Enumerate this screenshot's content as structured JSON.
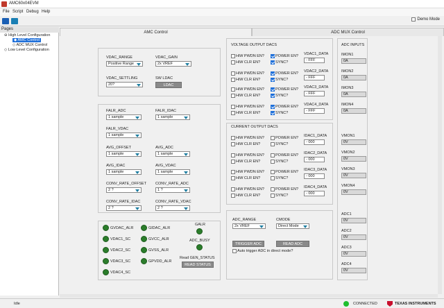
{
  "app": {
    "title": "AMC60x04EVM"
  },
  "menu": [
    "File",
    "Script",
    "Debug",
    "Help"
  ],
  "toolbar": {
    "demo_mode_label": "Demo Mode",
    "demo_mode_checked": false
  },
  "pages": {
    "header": "Pages",
    "items": [
      "High Level Configuration",
      "AMC Control",
      "ADC MUX Control",
      "Low Level Configuration"
    ],
    "selected": "AMC Control"
  },
  "tabs": {
    "amc": "AMC Control",
    "adcmux": "ADC MUX Control"
  },
  "vdac": {
    "range_label": "VDAC_RANGE",
    "range_value": "Positive Range",
    "gain_label": "VDAC_GAIN",
    "gain_value": "2x VREF",
    "settling_label": "VDAC_SETTLING",
    "settling_value": "20?",
    "sw_ldac_label": "SW LDAC",
    "ldac_button": "LDAC"
  },
  "falr": {
    "falr_adc_label": "FALR_ADC",
    "falr_adc_value": "1 sample",
    "falr_idac_label": "FALR_IDAC",
    "falr_idac_value": "1 sample",
    "falr_vdac_label": "FALR_VDAC",
    "falr_vdac_value": "1 sample",
    "avg_offset_label": "AVG_OFFSET",
    "avg_offset_value": "1 sample",
    "avg_adc_label": "AVG_ADC",
    "avg_adc_value": "1 sample",
    "avg_idac_label": "AVG_IDAC",
    "avg_idac_value": "1 sample",
    "avg_vdac_label": "AVG_VDAC",
    "avg_vdac_value": "1 sample",
    "conv_offset_label": "CONV_RATE_OFFSET",
    "conv_offset_value": "2 ?",
    "conv_adc_label": "CONV_RATE_ADC",
    "conv_adc_value": "1 ?",
    "conv_idac_label": "CONV_RATE_IDAC",
    "conv_idac_value": "2 ?",
    "conv_vdac_label": "CONV_RATE_VDAC",
    "conv_vdac_value": "2 ?"
  },
  "alarms": {
    "left": [
      "GVDAC_ALR",
      "VDAC1_SC",
      "VDAC2_SC",
      "VDAC3_SC",
      "VDAC4_SC"
    ],
    "mid": [
      "GIDAC_ALR",
      "GVCC_ALR",
      "GVSS_ALR",
      "GPVDD_ALR"
    ],
    "galr": "GALR",
    "adc_busy": "ADC_BUSY",
    "read_gen_status": "Read GEN_STATUS",
    "read_status_button": "READ STATUS"
  },
  "voltage_dacs": {
    "title": "VOLTAGE OUTPUT DACS",
    "hiw_pwdn": "HiW PWDN EN?",
    "hiw_clr": "HiW CLR EN?",
    "power": "POWER EN?",
    "sync": "SYNC?",
    "channels": [
      {
        "label": "VDAC1_DATA",
        "value": "- FFF"
      },
      {
        "label": "VDAC2_DATA",
        "value": "- FFF"
      },
      {
        "label": "VDAC3_DATA",
        "value": "- FFF"
      },
      {
        "label": "VDAC4_DATA",
        "value": "- FFF"
      }
    ]
  },
  "current_dacs": {
    "title": "CURRENT OUTPUT DACS",
    "channels": [
      {
        "label": "IDAC1_DATA",
        "value": "- 000"
      },
      {
        "label": "IDAC2_DATA",
        "value": "- 000"
      },
      {
        "label": "IDAC3_DATA",
        "value": "- 000"
      },
      {
        "label": "IDAC4_DATA",
        "value": "- 000"
      }
    ]
  },
  "adc_ctrl": {
    "range_label": "ADC_RANGE",
    "range_value": "2x VREF",
    "cmode_label": "CMODE",
    "cmode_value": "Direct Mode",
    "trigger_button": "TRIGGER ADC",
    "read_button": "READ ADC",
    "auto_trigger": "Auto trigger ADC in direct mode?"
  },
  "adc_inputs": {
    "title": "ADC INPUTS",
    "items": [
      {
        "label": "IMON1",
        "value": "0A"
      },
      {
        "label": "IMON2",
        "value": "0A"
      },
      {
        "label": "IMON3",
        "value": "0A"
      },
      {
        "label": "IMON4",
        "value": "0A"
      },
      {
        "label": "VMON1",
        "value": "0V"
      },
      {
        "label": "VMON2",
        "value": "0V"
      },
      {
        "label": "VMON3",
        "value": "0V"
      },
      {
        "label": "VMON4",
        "value": "0V"
      },
      {
        "label": "ADC1",
        "value": "0V"
      },
      {
        "label": "ADC2",
        "value": "0V"
      },
      {
        "label": "ADC3",
        "value": "0V"
      },
      {
        "label": "ADC4",
        "value": "0V"
      }
    ]
  },
  "status": {
    "left": "Idle",
    "connection": "CONNECTED",
    "brand": "TEXAS INSTRUMENTS"
  },
  "colors": {
    "led_green": "#2b7d2b",
    "connected_green": "#1fbf2f",
    "checkbox_blue": "#1e6fd9",
    "ti_red": "#c8102e"
  }
}
